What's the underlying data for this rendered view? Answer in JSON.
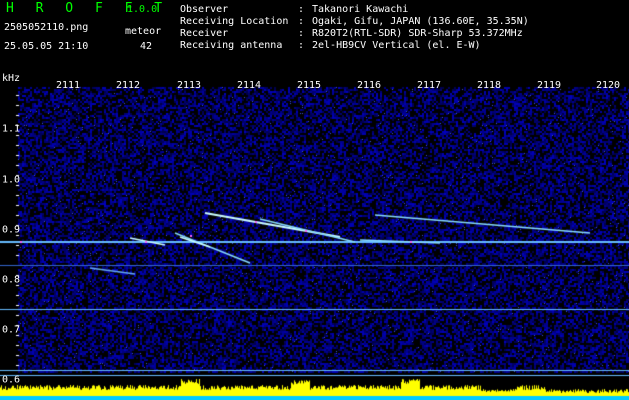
{
  "header": {
    "app_title": "H R O F F T",
    "version": "1.0.0",
    "filename": "2505052110.png",
    "timestamp": "25.05.05 21:10",
    "meteor_label": "meteor",
    "meteor_count": "42",
    "info": [
      {
        "key": "Observer",
        "value": "Takanori Kawachi"
      },
      {
        "key": "Receiving Location",
        "value": "Ogaki, Gifu, JAPAN (136.60E, 35.35N)"
      },
      {
        "key": "Receiver",
        "value": "R820T2(RTL-SDR) SDR-Sharp 53.372MHz"
      },
      {
        "key": "Receiving antenna",
        "value": "2el-HB9CV Vertical (el. E-W)"
      }
    ],
    "separator": ":"
  },
  "axis": {
    "unit": "kHz",
    "time_labels": [
      "2111",
      "2112",
      "2113",
      "2114",
      "2115",
      "2116",
      "2117",
      "2118",
      "2119",
      "2120"
    ],
    "freq_labels": [
      "1.1",
      "1.0",
      "0.9",
      "0.8",
      "0.7",
      "0.6"
    ]
  },
  "colors": {
    "background": "#000000",
    "noise": "#0a0a8c",
    "carrier": "#66bbff",
    "trail": "#ccffff",
    "hot": "#ff66ff",
    "spectrum_fill": "#ffff00",
    "spectrum_base": "#00ccff",
    "title": "#00ff00"
  }
}
